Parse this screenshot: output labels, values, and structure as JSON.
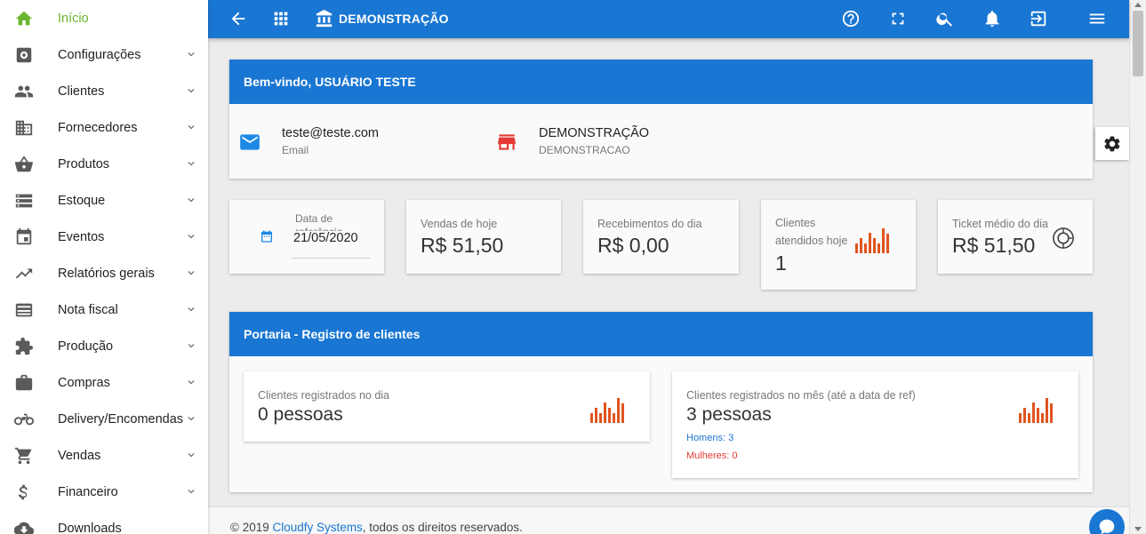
{
  "sidebar": {
    "items": [
      {
        "label": "Início",
        "icon": "home-icon",
        "active": true,
        "chevron": false
      },
      {
        "label": "Configurações",
        "icon": "settings-box-icon",
        "chevron": true
      },
      {
        "label": "Clientes",
        "icon": "people-icon",
        "chevron": true
      },
      {
        "label": "Fornecedores",
        "icon": "building-icon",
        "chevron": true
      },
      {
        "label": "Produtos",
        "icon": "basket-icon",
        "chevron": true
      },
      {
        "label": "Estoque",
        "icon": "storage-icon",
        "chevron": true
      },
      {
        "label": "Eventos",
        "icon": "calendar-icon",
        "chevron": true
      },
      {
        "label": "Relatórios gerais",
        "icon": "trending-up-icon",
        "chevron": true
      },
      {
        "label": "Nota fiscal",
        "icon": "card-icon",
        "chevron": true
      },
      {
        "label": "Produção",
        "icon": "puzzle-icon",
        "chevron": true
      },
      {
        "label": "Compras",
        "icon": "briefcase-icon",
        "chevron": true
      },
      {
        "label": "Delivery/Encomendas",
        "icon": "motorcycle-icon",
        "chevron": true
      },
      {
        "label": "Vendas",
        "icon": "cart-icon",
        "chevron": true
      },
      {
        "label": "Financeiro",
        "icon": "dollar-icon",
        "chevron": true
      },
      {
        "label": "Downloads",
        "icon": "cloud-download-icon",
        "chevron": false
      }
    ]
  },
  "topbar": {
    "title": "DEMONSTRAÇÃO",
    "color": "#1976d2"
  },
  "welcome": {
    "title": "Bem-vindo, USUÁRIO TESTE",
    "email_value": "teste@teste.com",
    "email_label": "Email",
    "store_value": "DEMONSTRAÇÃO",
    "store_label": "DEMONSTRACAO"
  },
  "stats": {
    "date_label": "Data de referência",
    "date_value": "21/05/2020",
    "sales_label": "Vendas de hoje",
    "sales_value": "R$ 51,50",
    "receipts_label": "Recebimentos do dia",
    "receipts_value": "R$ 0,00",
    "clients_label": "Clientes atendidos hoje",
    "clients_value": "1",
    "ticket_label": "Ticket médio do dia",
    "ticket_value": "R$ 51,50"
  },
  "portaria": {
    "title": "Portaria - Registro de clientes",
    "day_label": "Clientes registrados no dia",
    "day_value": "0 pessoas",
    "month_label": "Clientes registrados no mês (até a data de ref)",
    "month_value": "3 pessoas",
    "men": "Homens: 3",
    "women": "Mulheres: 0"
  },
  "footer": {
    "prefix": "© 2019 ",
    "link": "Cloudfy Systems",
    "suffix": ", todos os direitos reservados."
  },
  "colors": {
    "accent_green": "#6bb42f",
    "bar_orange": "#e0541f",
    "men_blue": "#1976d2",
    "women_red": "#e53935"
  }
}
